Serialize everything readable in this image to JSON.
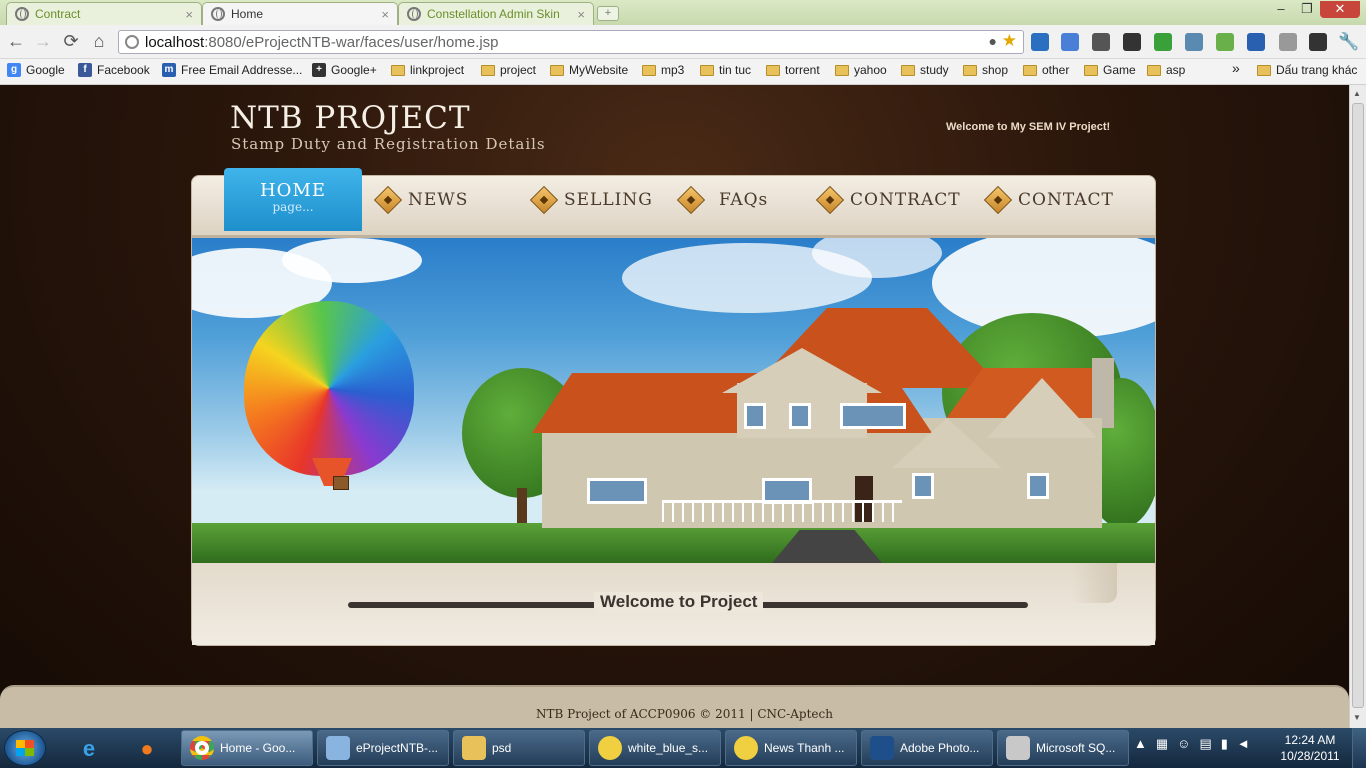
{
  "browser": {
    "tabs": [
      {
        "label": "Contract",
        "active": false
      },
      {
        "label": "Home",
        "active": true
      },
      {
        "label": "Constellation Admin Skin",
        "active": false
      }
    ],
    "new_tab_icon": "plus-icon",
    "close_glyph": "×",
    "window_controls": {
      "minimize": "–",
      "maximize": "❐",
      "close": "✕"
    },
    "url_host": "localhost",
    "url_path": ":8080/eProjectNTB-war/faces/user/home.jsp",
    "nav_glyphs": {
      "back": "←",
      "forward": "→",
      "reload": "⟳",
      "home": "⌂"
    },
    "bookmarks": [
      {
        "label": "Google",
        "icon": "google-icon",
        "color": "#4285f4"
      },
      {
        "label": "Facebook",
        "icon": "facebook-icon",
        "color": "#3b5998"
      },
      {
        "label": "Free Email Addresse...",
        "icon": "mail-icon",
        "color": "#2a5fb0"
      },
      {
        "label": "Google+",
        "icon": "gplus-icon",
        "color": "#333333"
      },
      {
        "label": "linkproject",
        "icon": "folder-icon"
      },
      {
        "label": "project",
        "icon": "folder-icon"
      },
      {
        "label": "MyWebsite",
        "icon": "folder-icon"
      },
      {
        "label": "mp3",
        "icon": "folder-icon"
      },
      {
        "label": "tin tuc",
        "icon": "folder-icon"
      },
      {
        "label": "torrent",
        "icon": "folder-icon"
      },
      {
        "label": "yahoo",
        "icon": "folder-icon"
      },
      {
        "label": "study",
        "icon": "folder-icon"
      },
      {
        "label": "shop",
        "icon": "folder-icon"
      },
      {
        "label": "other",
        "icon": "folder-icon"
      },
      {
        "label": "Game",
        "icon": "folder-icon"
      },
      {
        "label": "asp",
        "icon": "folder-icon"
      }
    ],
    "bookmarks_overflow": "»",
    "other_bookmarks": "Dấu trang khác"
  },
  "site": {
    "title": "NTB PROJECT",
    "subtitle": "Stamp Duty and Registration Details",
    "welcome_top": "Welcome to My SEM IV Project!",
    "nav": {
      "home": "HOME",
      "home_sub": "page...",
      "items": [
        "NEWS",
        "SELLING",
        "FAQs",
        "CONTRACT",
        "CONTACT"
      ]
    },
    "welcome": "Welcome to Project",
    "footer": "NTB Project of ACCP0906 © 2011 | CNC-Aptech"
  },
  "taskbar": {
    "pinned": [
      {
        "icon": "internet-explorer-icon",
        "glyph": "e",
        "color": "#3aa0e8"
      },
      {
        "icon": "firefox-icon",
        "glyph": "●",
        "color": "#f07a1e"
      }
    ],
    "tasks": [
      {
        "label": "Home - Goo...",
        "icon": "chrome-icon",
        "active": true,
        "color": "#e0443a"
      },
      {
        "label": "eProjectNTB-...",
        "icon": "netbeans-icon",
        "active": false,
        "color": "#8ab4e0"
      },
      {
        "label": "psd",
        "icon": "folder-icon",
        "active": false,
        "color": "#e8c15a"
      },
      {
        "label": "white_blue_s...",
        "icon": "messenger-icon",
        "active": false,
        "color": "#f0d040"
      },
      {
        "label": "News Thanh ...",
        "icon": "messenger-icon",
        "active": false,
        "color": "#f0d040"
      },
      {
        "label": "Adobe Photo...",
        "icon": "photoshop-icon",
        "active": false,
        "color": "#1f4f8a"
      },
      {
        "label": "Microsoft SQ...",
        "icon": "sql-server-icon",
        "active": false,
        "color": "#c8c8c8"
      }
    ],
    "tray_glyphs": [
      "▲",
      "▦",
      "☺",
      "▤",
      "▮",
      "◄"
    ],
    "time": "12:24 AM",
    "date": "10/28/2011"
  }
}
